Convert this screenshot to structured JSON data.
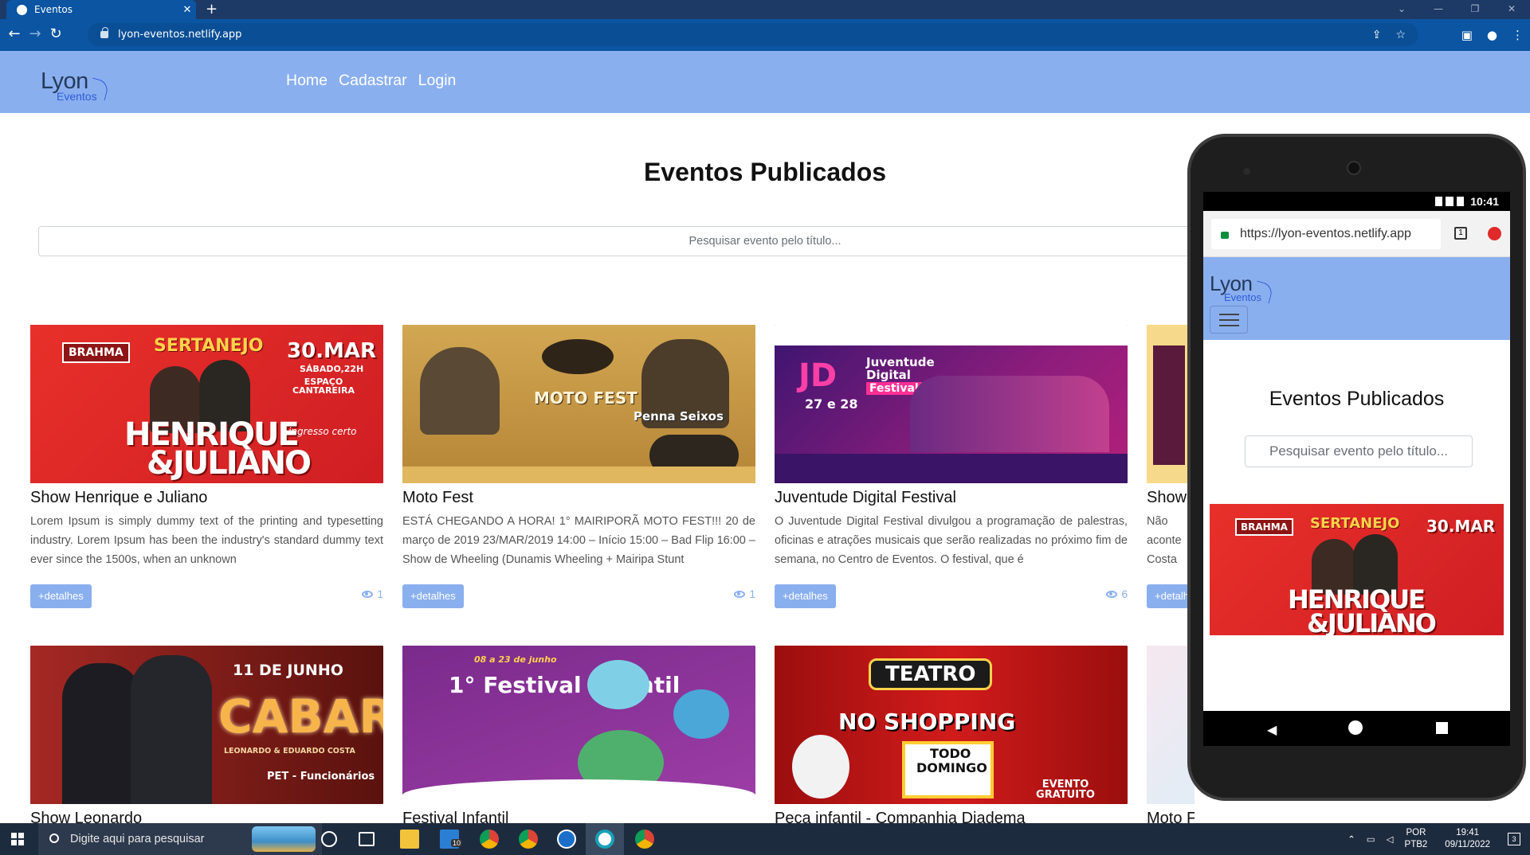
{
  "browser": {
    "tab_title": "Eventos",
    "new_tab": "+",
    "url": "lyon-eventos.netlify.app"
  },
  "site": {
    "logo_main": "Lyon",
    "logo_sub": "Eventos",
    "nav": [
      "Home",
      "Cadastrar",
      "Login"
    ],
    "page_title": "Eventos Publicados",
    "search_placeholder": "Pesquisar evento pelo título...",
    "details_label": "+detalhes"
  },
  "events": [
    {
      "title": "Show Henrique e Juliano",
      "description": "Lorem Ipsum is simply dummy text of the printing and typesetting industry. Lorem Ipsum has been the industry's standard dummy text ever since the 1500s, when an unknown",
      "views": "1"
    },
    {
      "title": "Moto Fest",
      "description": "ESTÁ CHEGANDO A HORA! 1° MAIRIPORÃ MOTO FEST!!! 20 de março de 2019 23/MAR/2019 14:00 – Início 15:00 – Bad Flip 16:00 – Show de Wheeling (Dunamis Wheeling + Mairipa Stunt",
      "views": "1"
    },
    {
      "title": "Juventude Digital Festival",
      "description": "O Juventude Digital Festival divulgou a programação de palestras, oficinas e atrações musicais que serão realizadas no próximo fim de semana, no Centro de Eventos. O festival, que é",
      "views": "6"
    },
    {
      "title": "Show",
      "description": "Não p aconte Costa",
      "views": ""
    },
    {
      "title": "Show Leonardo"
    },
    {
      "title": "Festival Infantil"
    },
    {
      "title": "Peça infantil - Companhia Diadema"
    },
    {
      "title": "Moto Fest"
    }
  ],
  "posters": {
    "hj_top": "30.MAR",
    "hj_sub": "SÁBADO,22H",
    "hj_venue": "ESPAÇO CANTAREIRA",
    "hj_brand": "BRAHMA",
    "hj_genre": "SERTANEJO",
    "hj_name1": "HENRIQUE",
    "hj_name2": "&JULIANO",
    "hj_ticket": "ingresso certo",
    "moto_title": "MOTO FEST",
    "moto_band": "Penna Seixos",
    "jd_title1": "Juventude",
    "jd_title2": "Digital",
    "jd_title3": "Festival",
    "jd_date": "27 e 28",
    "cab_date": "11 DE JUNHO",
    "cab_title": "CABARÉ",
    "cab_artists": "LEONARDO & EDUARDO COSTA",
    "cab_pet": "PET - Funcionários",
    "fest_title": "1° Festival Infantil",
    "fest_date": "08 a 23 de junho",
    "tea_title": "TEATRO",
    "tea_sub": "NO SHOPPING",
    "tea_day1": "TODO",
    "tea_day2": "DOMINGO",
    "tea_free": "EVENTO GRATUITO"
  },
  "phone": {
    "time": "10:41",
    "url": "https://lyon-eventos.netlify.app",
    "tab_count": "1"
  },
  "taskbar": {
    "search_placeholder": "Digite aqui para pesquisar",
    "lang1": "POR",
    "lang2": "PTB2",
    "time": "19:41",
    "date": "09/11/2022",
    "notif": "3",
    "mail_badge": "10"
  }
}
